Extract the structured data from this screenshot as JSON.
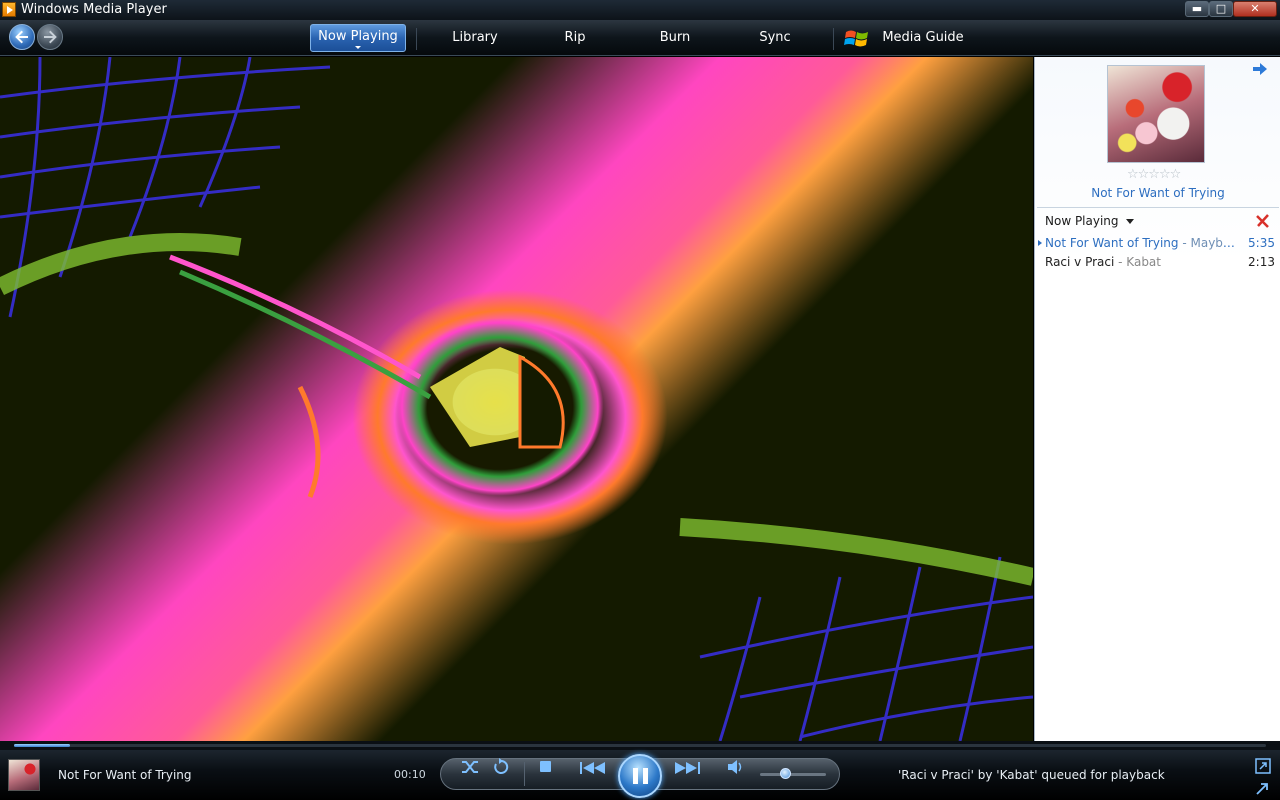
{
  "window": {
    "title": "Windows Media Player",
    "min_glyph": "▬",
    "max_glyph": "□",
    "close_glyph": "✕"
  },
  "nav": {
    "tabs": [
      {
        "label": "Now Playing"
      },
      {
        "label": "Library"
      },
      {
        "label": "Rip"
      },
      {
        "label": "Burn"
      },
      {
        "label": "Sync"
      },
      {
        "label": "Media Guide"
      }
    ]
  },
  "pane": {
    "rating_stars": "☆☆☆☆☆",
    "album_title": "Not For Want of Trying",
    "list_header": "Now Playing",
    "tracks": [
      {
        "title": "Not For Want of Trying",
        "artist": " - Maybesh...",
        "duration": "5:35"
      },
      {
        "title": "Raci v Praci",
        "artist": " - Kabat",
        "duration": "2:13"
      }
    ]
  },
  "player": {
    "now_playing": "Not For Want of Trying",
    "elapsed": "00:10",
    "seek_progress": 0.045,
    "volume": 0.4,
    "status": "'Raci v Praci' by 'Kabat' queued for playback"
  },
  "colors": {
    "accent": "#2d6ec0",
    "tab_active": "#2a63b0",
    "link": "#2d6ec0"
  }
}
